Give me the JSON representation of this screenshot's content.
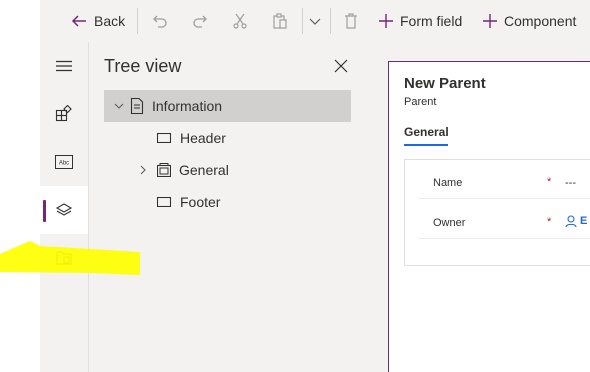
{
  "toolbar": {
    "back_label": "Back",
    "form_field_label": "Form field",
    "component_label": "Component"
  },
  "tree_view": {
    "title": "Tree view",
    "items": [
      {
        "label": "Information",
        "selected": true
      },
      {
        "label": "Header"
      },
      {
        "label": "General",
        "collapsed": true
      },
      {
        "label": "Footer"
      }
    ]
  },
  "form": {
    "title": "New Parent",
    "entity": "Parent",
    "tab": "General",
    "fields": [
      {
        "label": "Name",
        "required": "*",
        "value": "---"
      },
      {
        "label": "Owner",
        "required": "*",
        "value": "E"
      }
    ]
  },
  "colors": {
    "accent": "#742774",
    "link": "#2266e3",
    "highlight": "#ffff00",
    "required": "#a4262c"
  }
}
